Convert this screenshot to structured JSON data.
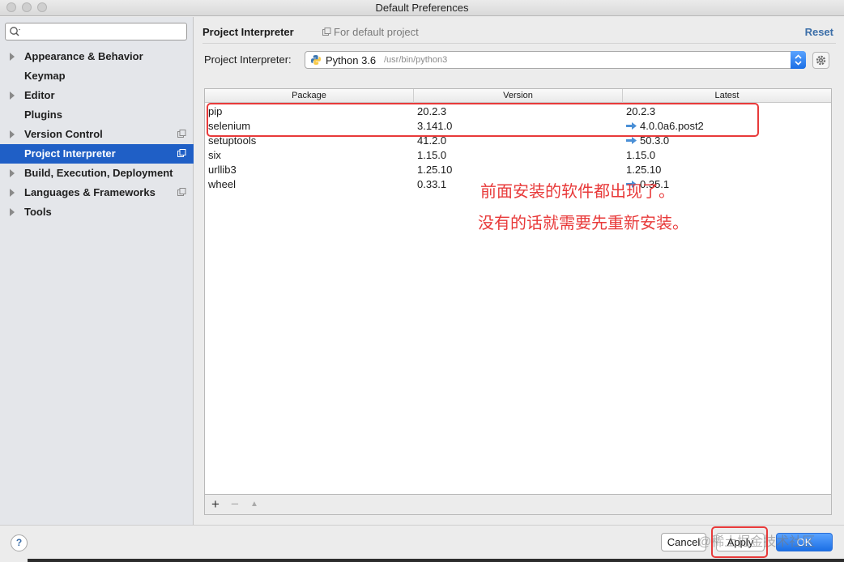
{
  "window": {
    "title": "Default Preferences"
  },
  "sidebar": {
    "search": {
      "placeholder": ""
    },
    "items": [
      {
        "label": "Appearance & Behavior",
        "expandable": true,
        "has_copy_icon": false,
        "active": false
      },
      {
        "label": "Keymap",
        "expandable": false,
        "has_copy_icon": false,
        "active": false
      },
      {
        "label": "Editor",
        "expandable": true,
        "has_copy_icon": false,
        "active": false
      },
      {
        "label": "Plugins",
        "expandable": false,
        "has_copy_icon": false,
        "active": false
      },
      {
        "label": "Version Control",
        "expandable": true,
        "has_copy_icon": true,
        "active": false
      },
      {
        "label": "Project Interpreter",
        "expandable": false,
        "has_copy_icon": true,
        "active": true
      },
      {
        "label": "Build, Execution, Deployment",
        "expandable": true,
        "has_copy_icon": false,
        "active": false
      },
      {
        "label": "Languages & Frameworks",
        "expandable": true,
        "has_copy_icon": true,
        "active": false
      },
      {
        "label": "Tools",
        "expandable": true,
        "has_copy_icon": false,
        "active": false
      }
    ]
  },
  "header": {
    "title": "Project Interpreter",
    "subtitle": "For default project",
    "reset_label": "Reset"
  },
  "interpreter": {
    "label": "Project Interpreter:",
    "name": "Python 3.6",
    "path": "/usr/bin/python3"
  },
  "packages": {
    "columns": [
      "Package",
      "Version",
      "Latest"
    ],
    "rows": [
      {
        "package": "pip",
        "version": "20.2.3",
        "latest": "20.2.3",
        "upgrade": false
      },
      {
        "package": "selenium",
        "version": "3.141.0",
        "latest": "4.0.0a6.post2",
        "upgrade": true
      },
      {
        "package": "setuptools",
        "version": "41.2.0",
        "latest": "50.3.0",
        "upgrade": true
      },
      {
        "package": "six",
        "version": "1.15.0",
        "latest": "1.15.0",
        "upgrade": false
      },
      {
        "package": "urllib3",
        "version": "1.25.10",
        "latest": "1.25.10",
        "upgrade": false
      },
      {
        "package": "wheel",
        "version": "0.33.1",
        "latest": "0.35.1",
        "upgrade": true
      }
    ],
    "toolbar": {
      "add": "+",
      "remove": "−",
      "upgrade": "▲"
    }
  },
  "annotations": {
    "line1": "前面安装的软件都出现了。",
    "line2": "没有的话就需要先重新安装。",
    "color": "#e83a3a"
  },
  "footer": {
    "help_label": "?",
    "cancel_label": "Cancel",
    "apply_label": "Apply",
    "ok_label": "OK",
    "watermark": "@稀土掘金技术社区"
  },
  "colors": {
    "accent": "#1f5fc6",
    "link": "#3b6ea8",
    "annotation": "#e83a3a"
  }
}
